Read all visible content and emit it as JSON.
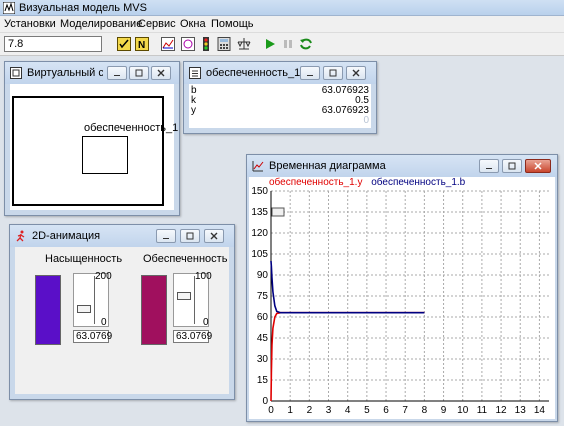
{
  "app": {
    "title": "Визуальная модель MVS"
  },
  "menu": [
    "Установки",
    "Моделирование",
    "Сервис",
    "Окна",
    "Помощь"
  ],
  "toolbar": {
    "time_value": "7.8",
    "icons": [
      "variables-icon",
      "n-icon",
      "chart-icon",
      "phase-icon",
      "traffic-light-icon",
      "calculator-icon",
      "scales-icon",
      "play-icon",
      "pause-icon",
      "restart-icon"
    ]
  },
  "windows": {
    "virtual": {
      "title": "Виртуальный с...",
      "label": "обеспеченность_1"
    },
    "obesp": {
      "title": "обеспеченность_1",
      "rows": [
        {
          "name": "b",
          "value": "63.076923"
        },
        {
          "name": "k",
          "value": "0.5"
        },
        {
          "name": "y",
          "value": "63.076923"
        },
        {
          "name": "",
          "value": "0"
        }
      ]
    },
    "anim": {
      "title": "2D-анимация",
      "left": {
        "label": "Насыщенность",
        "max": "200",
        "min": "0",
        "value": "63.0769",
        "fraction": 0.315,
        "color": "#5a0fc8"
      },
      "right": {
        "label": "Обеспеченность",
        "max": "100",
        "min": "0",
        "value": "63.0769",
        "fraction": 0.63,
        "color": "#a0105e"
      }
    },
    "chart": {
      "title": "Временная диаграмма",
      "legend": [
        {
          "name": "обеспеченность_1.y",
          "color": "#e00000"
        },
        {
          "name": "обеспеченность_1.b",
          "color": "#000080"
        }
      ],
      "slider_value": "135"
    }
  },
  "chart_data": {
    "type": "line",
    "title": "Временная диаграмма",
    "xlim": [
      0,
      14.5
    ],
    "ylim": [
      0,
      150
    ],
    "x_ticks": [
      0,
      1,
      2,
      3,
      4,
      5,
      6,
      7,
      8,
      9,
      10,
      11,
      12,
      13,
      14
    ],
    "y_ticks": [
      0,
      15,
      30,
      45,
      60,
      75,
      90,
      105,
      120,
      135,
      150
    ],
    "grid": true,
    "legend_position": "top-left",
    "series": [
      {
        "name": "обеспеченность_1.y",
        "color": "#e00000",
        "x": [
          0,
          0.02,
          0.05,
          0.1,
          0.2,
          0.3,
          0.5,
          8
        ],
        "y": [
          0,
          20,
          40,
          52,
          60,
          62.5,
          63.07,
          63.07
        ]
      },
      {
        "name": "обеспеченность_1.b",
        "color": "#000080",
        "x": [
          0,
          0.02,
          0.05,
          0.1,
          0.2,
          0.3,
          0.5,
          8
        ],
        "y": [
          100,
          96,
          88,
          78,
          68,
          64,
          63.07,
          63.07
        ]
      }
    ]
  }
}
